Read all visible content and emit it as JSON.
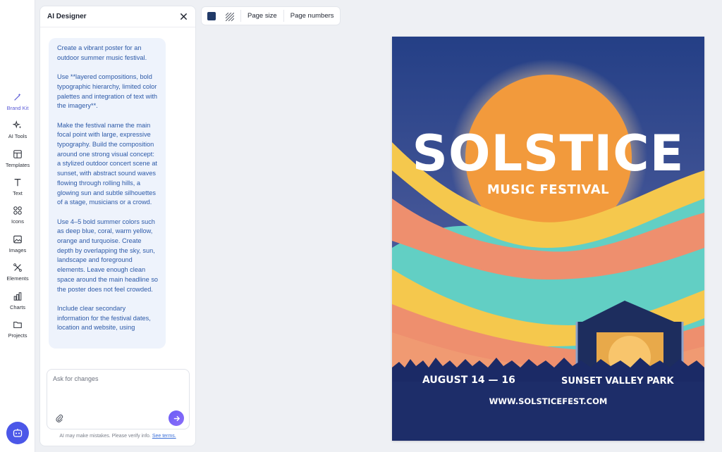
{
  "rail": {
    "items": [
      {
        "label": "Brand Kit",
        "icon": "magic-wand-icon"
      },
      {
        "label": "AI Tools",
        "icon": "sparkles-icon"
      },
      {
        "label": "Templates",
        "icon": "templates-icon"
      },
      {
        "label": "Text",
        "icon": "text-icon"
      },
      {
        "label": "Icons",
        "icon": "shapes-icon"
      },
      {
        "label": "Images",
        "icon": "image-icon"
      },
      {
        "label": "Elements",
        "icon": "elements-icon"
      },
      {
        "label": "Charts",
        "icon": "bar-chart-icon"
      },
      {
        "label": "Projects",
        "icon": "folder-icon"
      }
    ]
  },
  "panel": {
    "title": "AI Designer",
    "message": [
      "Create a vibrant poster for an outdoor summer music festival.",
      "Use **layered compositions, bold typographic hierarchy, limited color palettes and integration of text with the imagery**.",
      "Make the festival name the main focal point with large, expressive typography. Build the composition around one strong visual concept: a stylized outdoor concert scene at sunset, with abstract sound waves flowing through rolling hills, a glowing sun and subtle silhouettes of a stage, musicians or a crowd.",
      "Use 4–5 bold summer colors such as deep blue, coral, warm yellow, orange and turquoise. Create depth by overlapping the sky, sun, landscape and foreground elements. Leave enough clean space around the main headline so the poster does not feel crowded.",
      "Include clear secondary information for the festival dates, location and website, using"
    ],
    "input_placeholder": "Ask for changes",
    "disclaimer": "AI may make mistakes. Please verify info.",
    "disclaimer_link": "See terms."
  },
  "toolbar": {
    "color": "#213a68",
    "page_size": "Page size",
    "page_numbers": "Page numbers"
  },
  "poster": {
    "title": "SOLSTICE",
    "subtitle": "MUSIC FESTIVAL",
    "dates": "AUGUST 14 — 16",
    "location": "SUNSET VALLEY PARK",
    "website": "WWW.SOLSTICEFEST.COM",
    "colors": {
      "sky": "#2a4a8f",
      "sun": "#f29a3c",
      "coral": "#ee8f6e",
      "yellow": "#f5c84d",
      "turquoise": "#62cfc4",
      "navy": "#1d2d5e"
    }
  }
}
